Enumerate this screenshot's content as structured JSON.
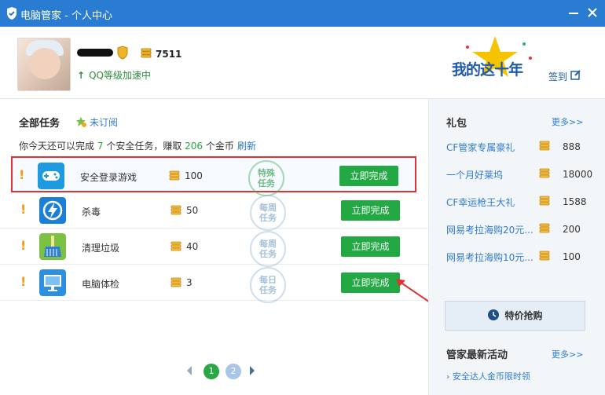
{
  "window": {
    "title": "电脑管家 - 个人中心"
  },
  "profile": {
    "coins": "7511",
    "qq_speed": "QQ等级加速中"
  },
  "badge": {
    "text": "我的这十年"
  },
  "signin_label": "签到",
  "tasks": {
    "tab_label": "全部任务",
    "sub_label": "未订阅",
    "desc_prefix": "你今天还可以完成",
    "desc_count": "7",
    "desc_mid": "个安全任务，赚取",
    "desc_coins": "206",
    "desc_suffix": "个金币",
    "refresh": "刷新",
    "items": [
      {
        "name": "安全登录游戏",
        "coins": "100",
        "stamp": "特殊\n任务",
        "button": "立即完成"
      },
      {
        "name": "杀毒",
        "coins": "50",
        "stamp": "每周\n任务",
        "button": "立即完成"
      },
      {
        "name": "清理垃圾",
        "coins": "40",
        "stamp": "每周\n任务",
        "button": "立即完成"
      },
      {
        "name": "电脑体检",
        "coins": "3",
        "stamp": "每日\n任务",
        "button": "立即完成"
      }
    ]
  },
  "pager": {
    "page1": "1",
    "page2": "2"
  },
  "gifts": {
    "title": "礼包",
    "more": "更多>>",
    "items": [
      {
        "name": "CF管家专属豪礼",
        "value": "888"
      },
      {
        "name": "一个月好莱坞",
        "value": "18000"
      },
      {
        "name": "CF幸运枪王大礼",
        "value": "1588"
      },
      {
        "name": "网易考拉海购20元...",
        "value": "200"
      },
      {
        "name": "网易考拉海购10元...",
        "value": "100"
      }
    ]
  },
  "special_label": "特价抢购",
  "activities": {
    "title": "管家最新活动",
    "more": "更多>>",
    "item": "安全达人金币限时领"
  },
  "colors": {
    "title_blue": "#2a7bd2",
    "accent_green": "#22a944",
    "link_blue": "#2e7bd0",
    "coin_gold": "#e1a21b"
  }
}
